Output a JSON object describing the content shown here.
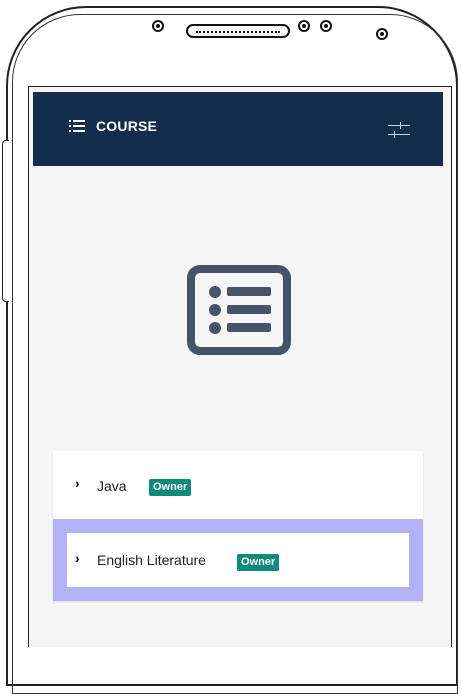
{
  "app": {
    "title": "COURSE"
  },
  "icons": {
    "menu": "menu-icon",
    "filter": "filter-sliders-icon",
    "illustration": "list-icon"
  },
  "colors": {
    "appbar": "#142d4c",
    "badge": "#0f8a7b",
    "selected_highlight": "#b4b1f7",
    "illustration": "#455468"
  },
  "courses": [
    {
      "name": "Java",
      "badge": "Owner",
      "selected": false
    },
    {
      "name": "English Literature",
      "badge": "Owner",
      "selected": true
    }
  ]
}
